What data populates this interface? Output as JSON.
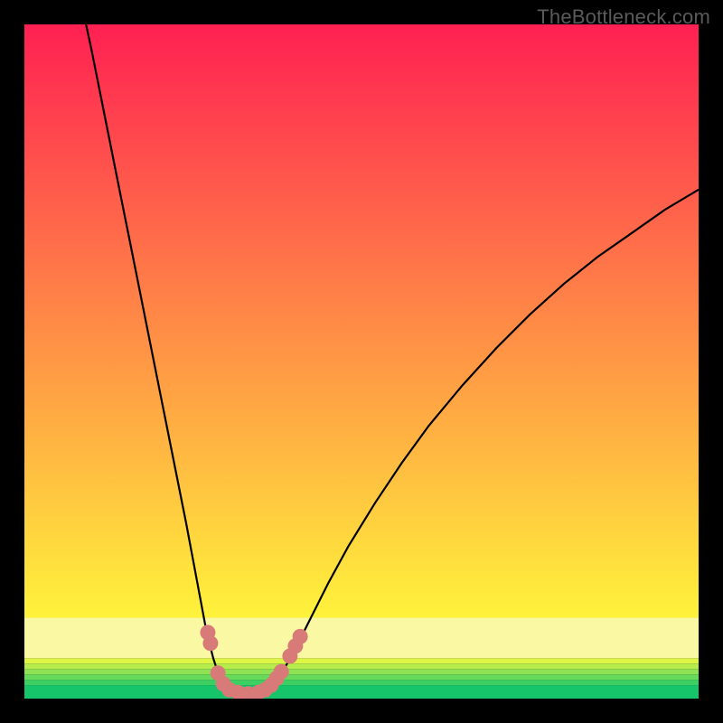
{
  "watermark": "TheBottleneck.com",
  "chart_data": {
    "type": "line",
    "title": "",
    "xlabel": "",
    "ylabel": "",
    "xlim": [
      0,
      100
    ],
    "ylim": [
      0,
      100
    ],
    "background_bands": [
      {
        "y0": 0,
        "y1": 2,
        "color": "#16c56a"
      },
      {
        "y0": 2,
        "y1": 2.8,
        "color": "#3ecf63"
      },
      {
        "y0": 2.8,
        "y1": 3.6,
        "color": "#67d95b"
      },
      {
        "y0": 3.6,
        "y1": 4.4,
        "color": "#8fe254"
      },
      {
        "y0": 4.4,
        "y1": 5.2,
        "color": "#b7ec4d"
      },
      {
        "y0": 5.2,
        "y1": 6,
        "color": "#def545"
      },
      {
        "y0": 6,
        "y1": 12,
        "color": "#fbf8a4"
      },
      {
        "y0": 12,
        "y1": 100,
        "gradient": [
          "#fff33b",
          "#ff2052"
        ]
      }
    ],
    "series": [
      {
        "name": "curve",
        "style": "black-line",
        "points": [
          {
            "x": 8.5,
            "y": 103
          },
          {
            "x": 10,
            "y": 96
          },
          {
            "x": 12,
            "y": 86
          },
          {
            "x": 14,
            "y": 76
          },
          {
            "x": 16,
            "y": 66
          },
          {
            "x": 18,
            "y": 56
          },
          {
            "x": 20,
            "y": 46
          },
          {
            "x": 22,
            "y": 36
          },
          {
            "x": 24,
            "y": 26
          },
          {
            "x": 25.5,
            "y": 18
          },
          {
            "x": 27,
            "y": 10
          },
          {
            "x": 28,
            "y": 6
          },
          {
            "x": 29,
            "y": 3
          },
          {
            "x": 30,
            "y": 1.5
          },
          {
            "x": 31.5,
            "y": 0.8
          },
          {
            "x": 33,
            "y": 0.6
          },
          {
            "x": 34.5,
            "y": 0.8
          },
          {
            "x": 36,
            "y": 1.3
          },
          {
            "x": 37,
            "y": 2.2
          },
          {
            "x": 38,
            "y": 3.5
          },
          {
            "x": 40,
            "y": 7
          },
          {
            "x": 42,
            "y": 11
          },
          {
            "x": 45,
            "y": 17
          },
          {
            "x": 48,
            "y": 22.5
          },
          {
            "x": 52,
            "y": 29
          },
          {
            "x": 56,
            "y": 35
          },
          {
            "x": 60,
            "y": 40.5
          },
          {
            "x": 65,
            "y": 46.5
          },
          {
            "x": 70,
            "y": 52
          },
          {
            "x": 75,
            "y": 57
          },
          {
            "x": 80,
            "y": 61.5
          },
          {
            "x": 85,
            "y": 65.5
          },
          {
            "x": 90,
            "y": 69
          },
          {
            "x": 95,
            "y": 72.5
          },
          {
            "x": 100,
            "y": 75.5
          }
        ]
      },
      {
        "name": "markers",
        "style": "salmon-dots",
        "points": [
          {
            "x": 27.2,
            "y": 9.8
          },
          {
            "x": 27.6,
            "y": 8.2
          },
          {
            "x": 28.7,
            "y": 3.8
          },
          {
            "x": 29.5,
            "y": 2.2
          },
          {
            "x": 30.4,
            "y": 1.3
          },
          {
            "x": 31.7,
            "y": 0.9
          },
          {
            "x": 33.2,
            "y": 0.7
          },
          {
            "x": 34.7,
            "y": 0.9
          },
          {
            "x": 35.7,
            "y": 1.3
          },
          {
            "x": 36.6,
            "y": 2.0
          },
          {
            "x": 37.4,
            "y": 3.0
          },
          {
            "x": 38.1,
            "y": 4.0
          },
          {
            "x": 39.4,
            "y": 6.3
          },
          {
            "x": 40.2,
            "y": 7.8
          },
          {
            "x": 40.9,
            "y": 9.2
          }
        ]
      }
    ]
  }
}
